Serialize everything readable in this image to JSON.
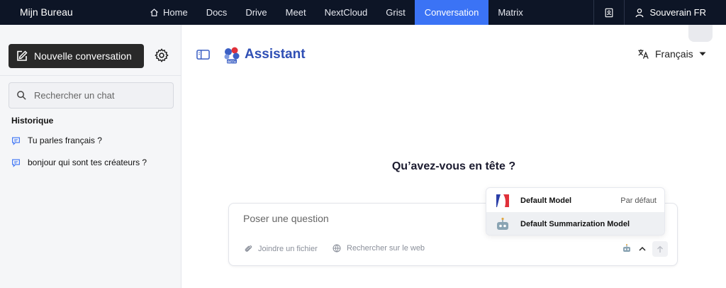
{
  "topbar": {
    "brand": "Mijn Bureau",
    "nav": [
      {
        "label": "Home",
        "icon": "home-icon"
      },
      {
        "label": "Docs"
      },
      {
        "label": "Drive"
      },
      {
        "label": "Meet"
      },
      {
        "label": "NextCloud"
      },
      {
        "label": "Grist"
      },
      {
        "label": "Conversation",
        "active": true
      },
      {
        "label": "Matrix"
      }
    ],
    "user": "Souverain FR",
    "accent": "#3b73f5",
    "bg": "#0d1526"
  },
  "sidebar": {
    "new_conversation": "Nouvelle conversation",
    "search_placeholder": "Rechercher un chat",
    "history_title": "Historique",
    "history": [
      {
        "label": "Tu parles français ?"
      },
      {
        "label": "bonjour qui sont tes créateurs ?"
      }
    ]
  },
  "header": {
    "app_title": "Assistant",
    "beta_badge": "BETA",
    "language": "Français"
  },
  "main": {
    "question": "Qu’avez-vous en tête ?",
    "input_placeholder": "Poser une question",
    "attach_label": "Joindre un fichier",
    "web_search_label": "Rechercher sur le web"
  },
  "model_menu": {
    "options": [
      {
        "label": "Default Model",
        "tag": "Par défaut",
        "icon": "french-flag-icon"
      },
      {
        "label": "Default Summarization Model",
        "tag": "",
        "icon": "robot-icon"
      }
    ]
  }
}
